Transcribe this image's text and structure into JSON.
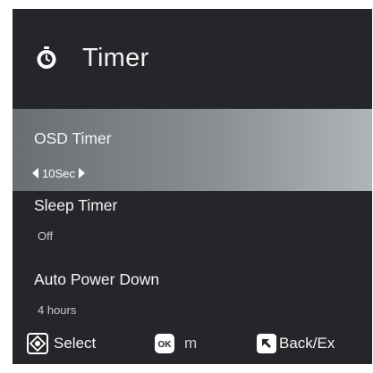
{
  "header": {
    "icon": "stopwatch-icon",
    "title": "Timer"
  },
  "menu": {
    "items": [
      {
        "label": "OSD Timer",
        "value": "10Sec",
        "selected": true
      },
      {
        "label": "Sleep Timer",
        "value": "Off",
        "selected": false
      },
      {
        "label": "Auto Power Down",
        "value": "4 hours",
        "selected": false
      }
    ]
  },
  "footer": {
    "select": {
      "icon": "dpad-icon",
      "label": "Select"
    },
    "ok": {
      "icon": "ok-button-icon",
      "icon_text": "OK",
      "label": "m"
    },
    "back": {
      "icon": "back-icon",
      "label": "Back/Ex"
    }
  },
  "colors": {
    "panel_bg": "#25262a",
    "highlight": "#8a8e93",
    "text": "#f5f5f5"
  }
}
